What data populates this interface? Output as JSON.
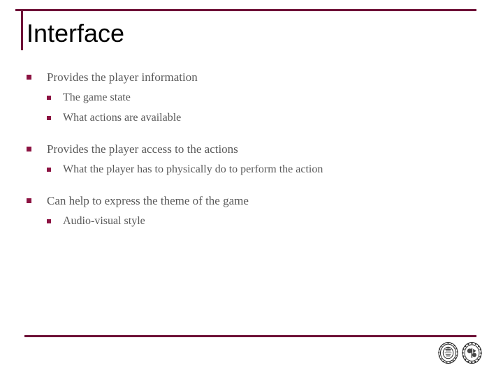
{
  "slide": {
    "title": "Interface",
    "accent_color": "#6e1137",
    "bullet_marker_color": "#8c1342",
    "body_text_color": "#595959",
    "title_text_color": "#000000",
    "background_color": "#ffffff"
  },
  "body": {
    "groups": [
      {
        "main": "Provides the player information",
        "sub": [
          "The game state",
          "What actions are available"
        ]
      },
      {
        "main": "Provides the player access to the actions",
        "sub": [
          "What the player has to physically do to perform the action"
        ]
      },
      {
        "main": "Can help to express the theme of the game",
        "sub": [
          "Audio-visual style"
        ]
      }
    ]
  },
  "footer": {
    "logos": [
      {
        "name": "university-seal-left"
      },
      {
        "name": "university-seal-right"
      }
    ]
  }
}
